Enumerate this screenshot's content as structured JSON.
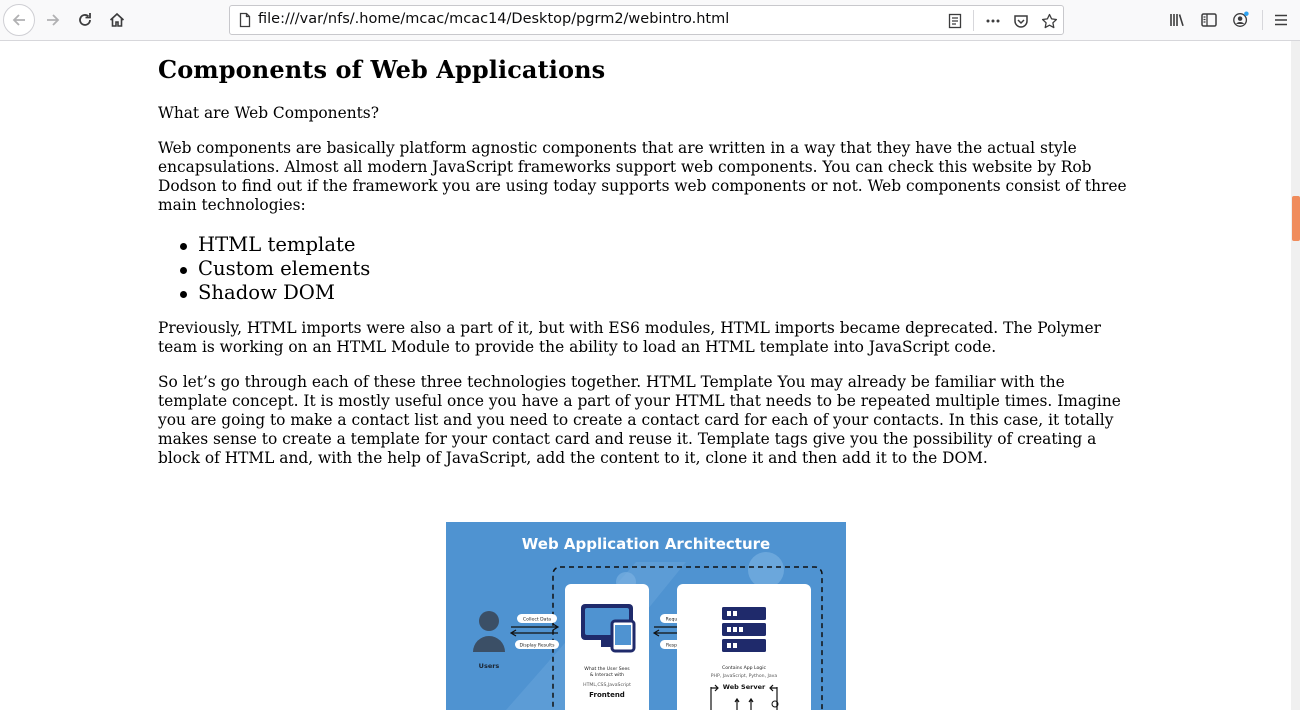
{
  "browser": {
    "url": "file:///var/nfs/.home/mcac/mcac14/Desktop/pgrm2/webintro.html",
    "icons": [
      "back-icon",
      "forward-icon",
      "reload-icon",
      "home-icon",
      "page-icon",
      "reader-view-icon",
      "more-icon",
      "pocket-icon",
      "bookmark-star-icon",
      "library-icon",
      "sidebar-icon",
      "account-icon",
      "menu-icon"
    ]
  },
  "page": {
    "title": "Components of Web Applications",
    "question": "What are Web Components?",
    "paragraph1": "Web components are basically platform agnostic components that are written in a way that they have the actual style encapsulations. Almost all modern JavaScript frameworks support web components. You can check this website by Rob Dodson to find out if the framework you are using today supports web components or not. Web components consist of three main technologies:",
    "technologies": [
      "HTML template",
      "Custom elements",
      "Shadow DOM"
    ],
    "paragraph2": "Previously, HTML imports were also a part of it, but with ES6 modules, HTML imports became deprecated. The Polymer team is working on an HTML Module to provide the ability to load an HTML template into JavaScript code.",
    "paragraph3": "So let’s go through each of these three technologies together. HTML Template You may already be familiar with the template concept. It is mostly useful once you have a part of your HTML that needs to be repeated multiple times. Imagine you are going to make a contact list and you need to create a contact card for each of your contacts. In this case, it totally makes sense to create a template for your contact card and reuse it. Template tags give you the possibility of creating a block of HTML and, with the help of JavaScript, add the content to it, clone it and then add it to the DOM."
  },
  "diagram": {
    "title": "Web Application Architecture",
    "users_label": "Users",
    "collect_data": "Collect Data",
    "display_results": "Display Results",
    "request": "Request",
    "response": "Response",
    "frontend_desc1": "What the User Sees",
    "frontend_desc2": "& Interact with",
    "frontend_tech": "HTML,CSS,JavaScript",
    "frontend_label": "Frontend",
    "backend_desc": "Contains App Logic",
    "backend_tech": "PHP, JavaScript, Python, Java",
    "web_server": "Web Server",
    "colors": {
      "background": "#4f93d1",
      "navy": "#1f2a6b",
      "accent": "#f08c5c"
    }
  }
}
